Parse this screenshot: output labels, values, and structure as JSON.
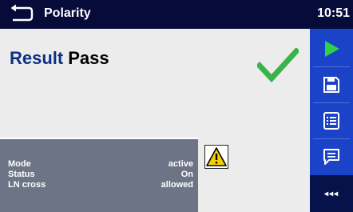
{
  "header": {
    "title": "Polarity",
    "time": "10:51",
    "back_icon": "back-arrow-icon"
  },
  "result": {
    "label": "Result",
    "value": "Pass",
    "status_icon": "check-icon",
    "status_color": "#3bb34a"
  },
  "params": [
    {
      "label": "Mode",
      "value": "active"
    },
    {
      "label": "Status",
      "value": "On"
    },
    {
      "label": "LN cross",
      "value": "allowed"
    }
  ],
  "warning_icon": "warning-triangle-icon",
  "sidebar": {
    "buttons": [
      {
        "icon": "play-icon"
      },
      {
        "icon": "save-icon"
      },
      {
        "icon": "list-icon"
      },
      {
        "icon": "comment-icon"
      }
    ],
    "more_label": "◂◂◂"
  },
  "colors": {
    "header_bg": "#070b3a",
    "sidebar_bg": "#1a43c8",
    "content_bg": "#ececec",
    "panel_bg": "#6c7486",
    "accent_green": "#3bb34a",
    "result_label": "#0e2f86"
  }
}
